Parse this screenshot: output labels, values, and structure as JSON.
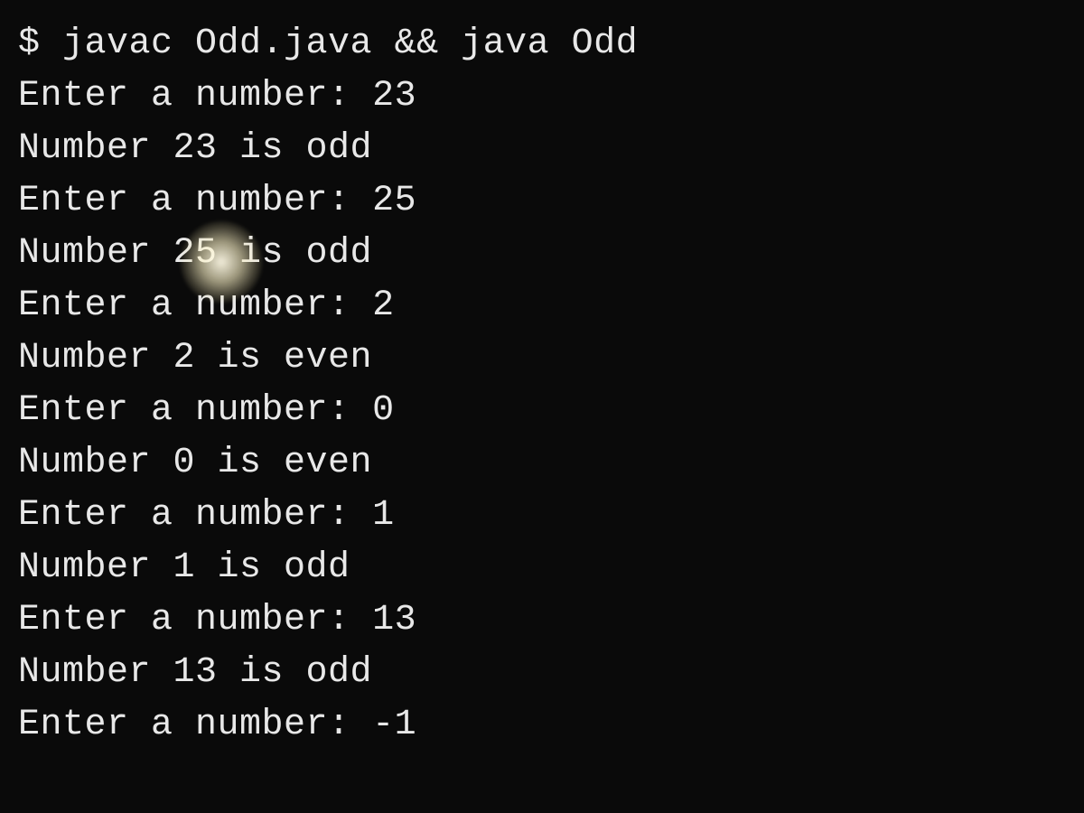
{
  "terminal": {
    "lines": [
      "$ javac Odd.java && java Odd",
      "Enter a number: 23",
      "Number 23 is odd",
      "Enter a number: 25",
      "Number 25 is odd",
      "Enter a number: 2",
      "Number 2 is even",
      "Enter a number: 0",
      "Number 0 is even",
      "Enter a number: 1",
      "Number 1 is odd",
      "Enter a number: 13",
      "Number 13 is odd",
      "Enter a number: -1"
    ]
  }
}
